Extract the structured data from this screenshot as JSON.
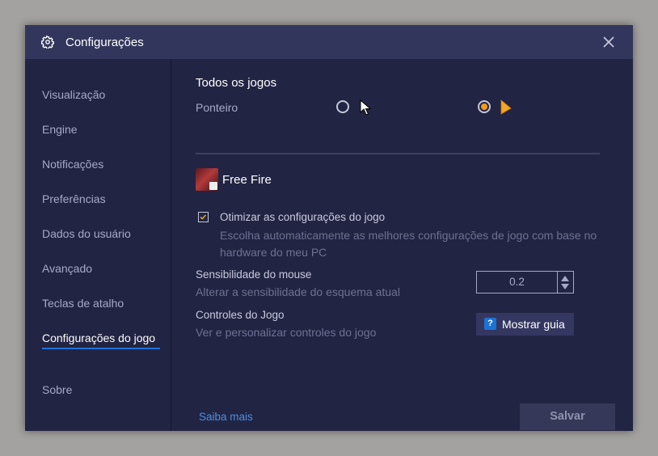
{
  "window": {
    "title": "Configurações",
    "icons": {
      "settings": "gear-icon",
      "close": "close-icon"
    }
  },
  "sidebar": {
    "items": [
      {
        "label": "Visualização",
        "active": false
      },
      {
        "label": "Engine",
        "active": false
      },
      {
        "label": "Notificações",
        "active": false
      },
      {
        "label": "Preferências",
        "active": false
      },
      {
        "label": "Dados do usuário",
        "active": false
      },
      {
        "label": "Avançado",
        "active": false
      },
      {
        "label": "Teclas de atalho",
        "active": false
      },
      {
        "label": "Configurações do jogo",
        "active": true
      },
      {
        "label": "Sobre",
        "active": false
      }
    ]
  },
  "all_games": {
    "title": "Todos os jogos",
    "pointer_label": "Ponteiro",
    "pointer_options": [
      {
        "name": "default-white-cursor",
        "selected": false
      },
      {
        "name": "orange-cursor",
        "selected": true
      }
    ]
  },
  "game": {
    "name": "Free Fire",
    "optimize": {
      "checked": true,
      "title": "Otimizar as configurações do jogo",
      "description": "Escolha automaticamente as melhores configurações de jogo com base no hardware do meu PC"
    },
    "mouse_sensitivity": {
      "title": "Sensibilidade do mouse",
      "description": "Alterar a sensibilidade do esquema atual",
      "value": "0.2"
    },
    "controls": {
      "title": "Controles do Jogo",
      "description": "Ver e personalizar controles do jogo",
      "button_label": "Mostrar guia",
      "button_icon": "?"
    }
  },
  "footer": {
    "learn_more": "Saiba mais",
    "save_label": "Salvar"
  },
  "colors": {
    "accent_orange": "#f39c12",
    "accent_blue": "#1f72d8",
    "link": "#4a90e2",
    "background": "#222443",
    "titlebar": "#33365c"
  }
}
